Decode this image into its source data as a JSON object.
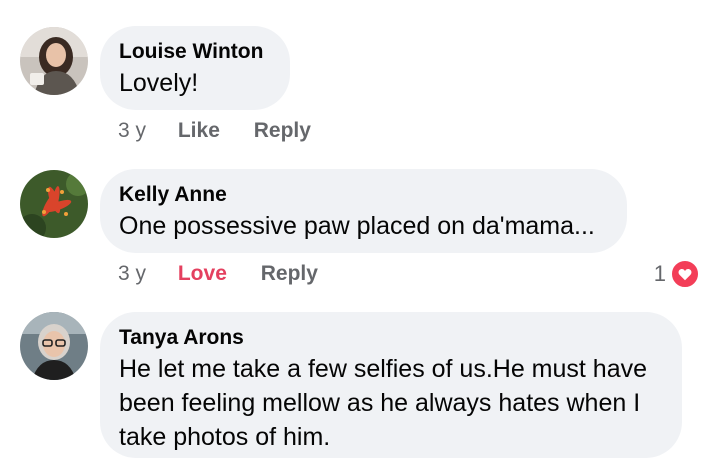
{
  "comments": [
    {
      "author": "Louise Winton",
      "text": "Lovely!",
      "time": "3 y",
      "actions": [
        "Like",
        "Reply"
      ],
      "reaction": null,
      "avatar_icon": "user-photo-woman-dark-hair"
    },
    {
      "author": "Kelly Anne",
      "text": "One possessive paw placed on da'mama...",
      "time": "3 y",
      "actions": [
        "Love",
        "Reply"
      ],
      "reaction": {
        "count": "1",
        "icon": "heart-icon",
        "color": "#f33e58"
      },
      "avatar_icon": "user-photo-red-flower"
    },
    {
      "author": "Tanya Arons",
      "text_lines": [
        "He let me take a few selfies of us.He must have",
        "been feeling mellow as he always hates when I",
        "take photos of him."
      ],
      "avatar_icon": "user-photo-woman-glasses"
    }
  ],
  "colors": {
    "bubble": "#f0f2f5",
    "meta_text": "#65676b",
    "love_active": "#e4405f"
  }
}
